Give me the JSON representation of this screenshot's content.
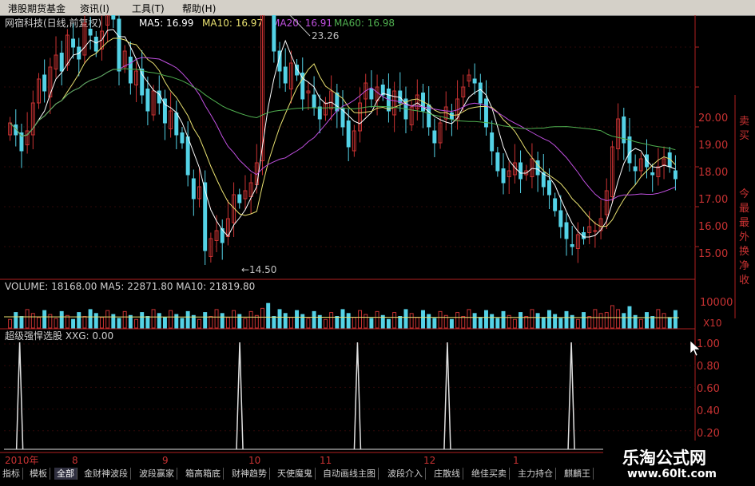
{
  "menu": {
    "items": [
      {
        "label": "港股期货基金"
      },
      {
        "label": "资讯(I)"
      },
      {
        "label": "工具(T)"
      },
      {
        "label": "帮助(H)"
      }
    ]
  },
  "header": {
    "name": "网宿科技(日线,前复权)",
    "ma5": "MA5: 16.99",
    "ma10": "MA10: 16.97",
    "ma20": "MA20: 16.91",
    "ma60": "MA60: 16.98"
  },
  "price_axis": [
    "20.00",
    "19.00",
    "18.00",
    "17.00",
    "16.00",
    "15.00"
  ],
  "annotations": {
    "high": "23.26",
    "low": "←14.50"
  },
  "volume_panel": {
    "header": "VOLUME: 18168.00 MA5: 22871.80 MA10: 21819.80",
    "axis_label": "10000",
    "unit": "X10"
  },
  "indicator_panel": {
    "header": "超级强悍选股 XXG: 0.00",
    "axis": [
      "1.00",
      "0.80",
      "0.60",
      "0.40",
      "0.20"
    ]
  },
  "right_panel": {
    "chars": [
      "卖",
      "买",
      "今",
      "最",
      "最",
      "外",
      "换",
      "净",
      "收"
    ]
  },
  "date_axis": [
    "2010年",
    "8",
    "9",
    "10",
    "11",
    "12",
    "1"
  ],
  "tabs": [
    "指标",
    "模板",
    "全部",
    "金财神波段",
    "波段赢家",
    "箱高箱底",
    "财神趋势",
    "天使魔鬼",
    "自动画线主图",
    "波段介入",
    "庄散线",
    "绝佳买卖",
    "主力持仓",
    "麒麟王"
  ],
  "active_tab": "全部",
  "watermark": {
    "name": "乐淘公式网",
    "url": "www.60lt.com"
  },
  "colors": {
    "up": "#c83232",
    "down": "#54d2e6",
    "ma5": "#ffffff",
    "ma10": "#e8e070",
    "ma20": "#c050e0",
    "ma60": "#50b050"
  },
  "chart_data": {
    "type": "candlestick",
    "title": "网宿科技(日线,前复权)",
    "price_ylim": [
      14.3,
      20.4
    ],
    "close": [
      18.1,
      17.8,
      17.4,
      17.9,
      18.6,
      19.2,
      18.9,
      19.5,
      19.8,
      19.4,
      20.3,
      20.0,
      19.7,
      20.6,
      20.3,
      19.9,
      20.4,
      20.9,
      20.7,
      19.4,
      19.9,
      19.1,
      19.4,
      18.8,
      18.4,
      18.9,
      18.6,
      18.1,
      18.4,
      17.8,
      17.6,
      16.8,
      16.2,
      16.5,
      14.9,
      15.2,
      15.4,
      15.1,
      15.7,
      16.3,
      16.1,
      16.4,
      16.6,
      17.1,
      21.4,
      21.0,
      19.9,
      19.4,
      19.1,
      19.6,
      19.3,
      18.7,
      18.9,
      18.5,
      18.2,
      18.6,
      18.9,
      18.4,
      18.0,
      17.5,
      17.9,
      18.6,
      19.1,
      18.7,
      19.0,
      18.8,
      18.4,
      18.9,
      18.6,
      18.2,
      18.5,
      18.8,
      18.4,
      18.0,
      17.6,
      18.1,
      18.5,
      18.2,
      18.7,
      19.0,
      19.3,
      19.1,
      18.6,
      18.0,
      17.4,
      16.9,
      16.6,
      16.9,
      17.1,
      16.7,
      16.9,
      17.2,
      16.8,
      16.5,
      16.3,
      15.9,
      15.5,
      15.2,
      15.0,
      15.3,
      15.2,
      15.5,
      15.4,
      15.7,
      16.4,
      17.5,
      18.2,
      17.6,
      17.1,
      16.9,
      17.2,
      17.0,
      16.8,
      17.0,
      17.2,
      17.0,
      16.7
    ],
    "ma_last": {
      "MA5": 16.99,
      "MA10": 16.97,
      "MA20": 16.91,
      "MA60": 16.98
    },
    "annotations": {
      "high": 23.26,
      "low": 14.5
    },
    "volume_header": {
      "VOLUME": 18168.0,
      "MA5": 22871.8,
      "MA10": 21819.8
    },
    "volume_ref": 10000,
    "signal_indices": [
      3,
      74,
      112,
      141,
      181
    ],
    "signal_ylim": [
      0,
      1.0
    ]
  }
}
